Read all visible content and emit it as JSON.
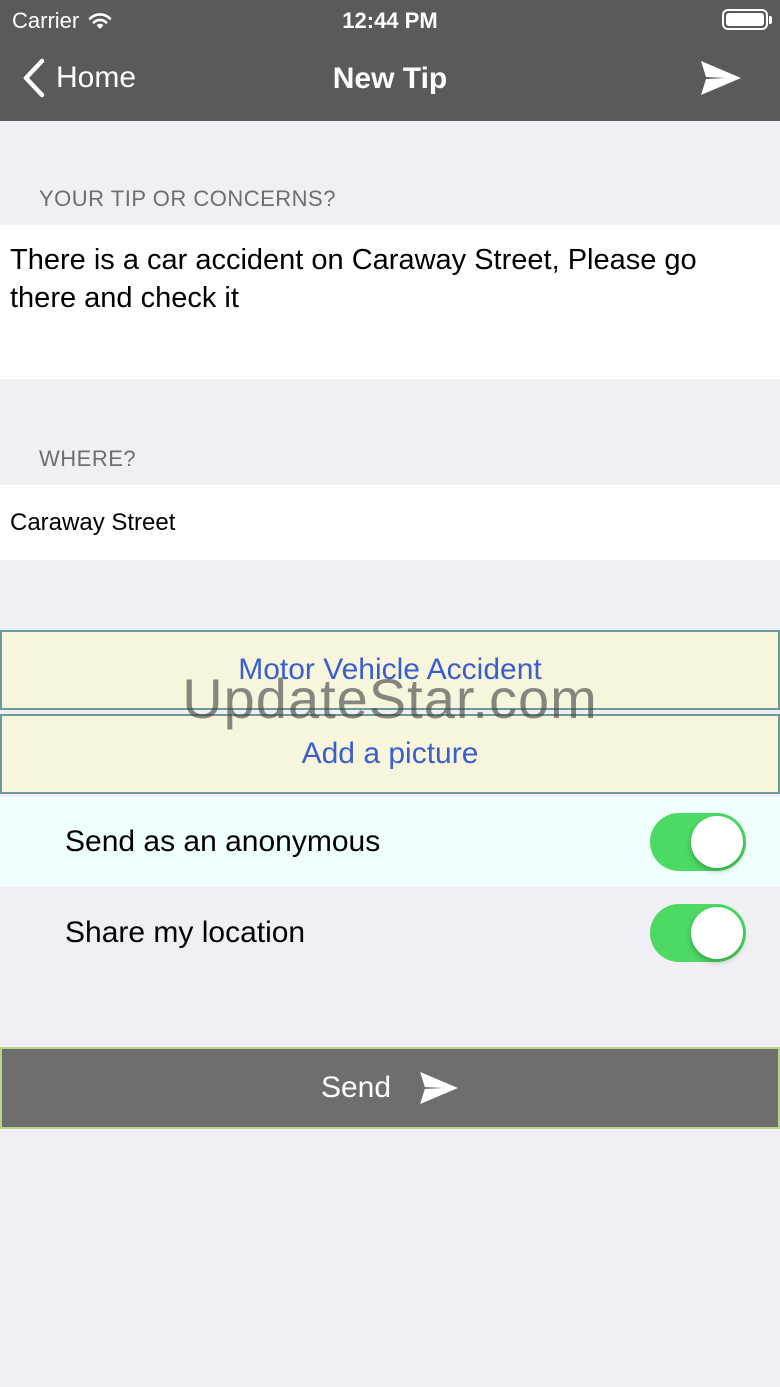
{
  "status_bar": {
    "carrier": "Carrier",
    "time": "12:44 PM"
  },
  "nav": {
    "back_label": "Home",
    "title": "New Tip"
  },
  "tip": {
    "section_label": "YOUR TIP OR CONCERNS?",
    "text": "There is a car accident on Caraway Street, Please go there and check it"
  },
  "where": {
    "section_label": "WHERE?",
    "value": "Caraway Street"
  },
  "category_button": {
    "label": "Motor Vehicle Accident"
  },
  "picture_button": {
    "label": "Add a picture"
  },
  "toggles": {
    "anonymous": {
      "label": "Send as an anonymous",
      "on": true
    },
    "location": {
      "label": "Share my location",
      "on": true
    }
  },
  "send_button": {
    "label": "Send"
  },
  "watermark": "UpdateStar.com",
  "colors": {
    "accent_green": "#4cd964",
    "link_blue": "#3a5fcd",
    "nav_gray": "#5a5a5a"
  }
}
